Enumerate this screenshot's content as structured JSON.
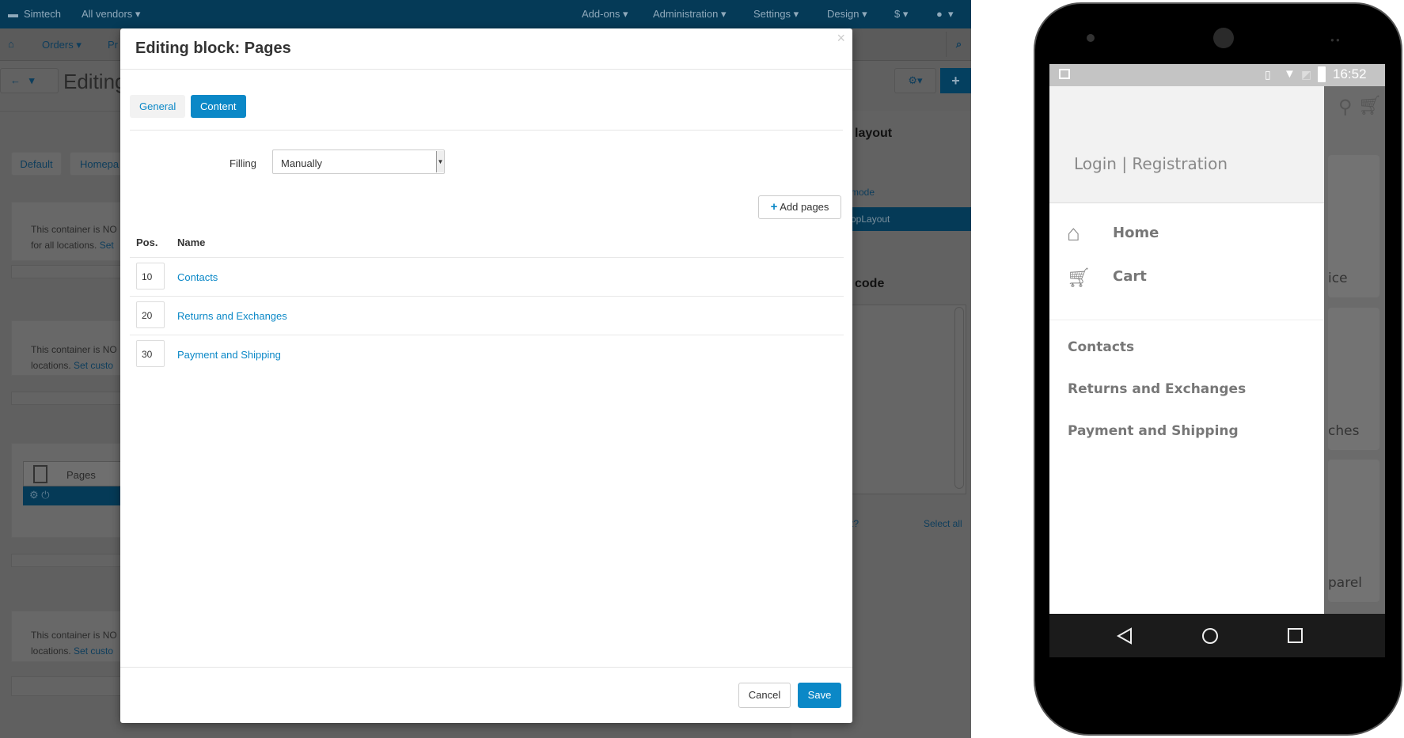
{
  "admin": {
    "topbar": {
      "store": "Simtech",
      "vendors": "All vendors ▾",
      "menu": [
        "Add-ons ▾",
        "Administration ▾",
        "Settings ▾",
        "Design ▾",
        "$ ▾",
        "▾"
      ]
    },
    "nav": {
      "orders": "Orders ▾",
      "products": "Pr"
    },
    "page_title": "Editing",
    "layout_tabs": [
      "Default",
      "Homepa"
    ],
    "containers": [
      {
        "line1": "This container is NO",
        "line2": "for all locations. ",
        "link": "Set"
      },
      {
        "line1": "This container is NO",
        "line2": "locations. ",
        "link": "Set custo"
      },
      {
        "line1": "This container is NO",
        "line2": "locations. ",
        "link": "Set custo"
      }
    ],
    "block_name": "Pages",
    "right_panel": {
      "layout_heading": "layout",
      "mode": "mode",
      "selected": "opLayout",
      "code_heading": "code",
      "question": "t?",
      "select_all": "Select all"
    }
  },
  "modal": {
    "title": "Editing block: Pages",
    "close": "×",
    "tabs": [
      {
        "label": "General",
        "active": false
      },
      {
        "label": "Content",
        "active": true
      }
    ],
    "filling_label": "Filling",
    "filling_value": "Manually",
    "add_pages": "Add pages",
    "columns": {
      "pos": "Pos.",
      "name": "Name"
    },
    "rows": [
      {
        "pos": "10",
        "name": "Contacts"
      },
      {
        "pos": "20",
        "name": "Returns and Exchanges"
      },
      {
        "pos": "30",
        "name": "Payment and Shipping"
      }
    ],
    "cancel": "Cancel",
    "save": "Save",
    "accent": "#0b88c7"
  },
  "phone": {
    "time": "16:52",
    "auth": "Login | Registration",
    "menu": [
      {
        "label": "Home",
        "icon": "home-icon"
      },
      {
        "label": "Cart",
        "icon": "cart-icon"
      }
    ],
    "pages": [
      "Contacts",
      "Returns and Exchanges",
      "Payment and Shipping"
    ],
    "behind": [
      "ice",
      "ches",
      "parel"
    ]
  }
}
